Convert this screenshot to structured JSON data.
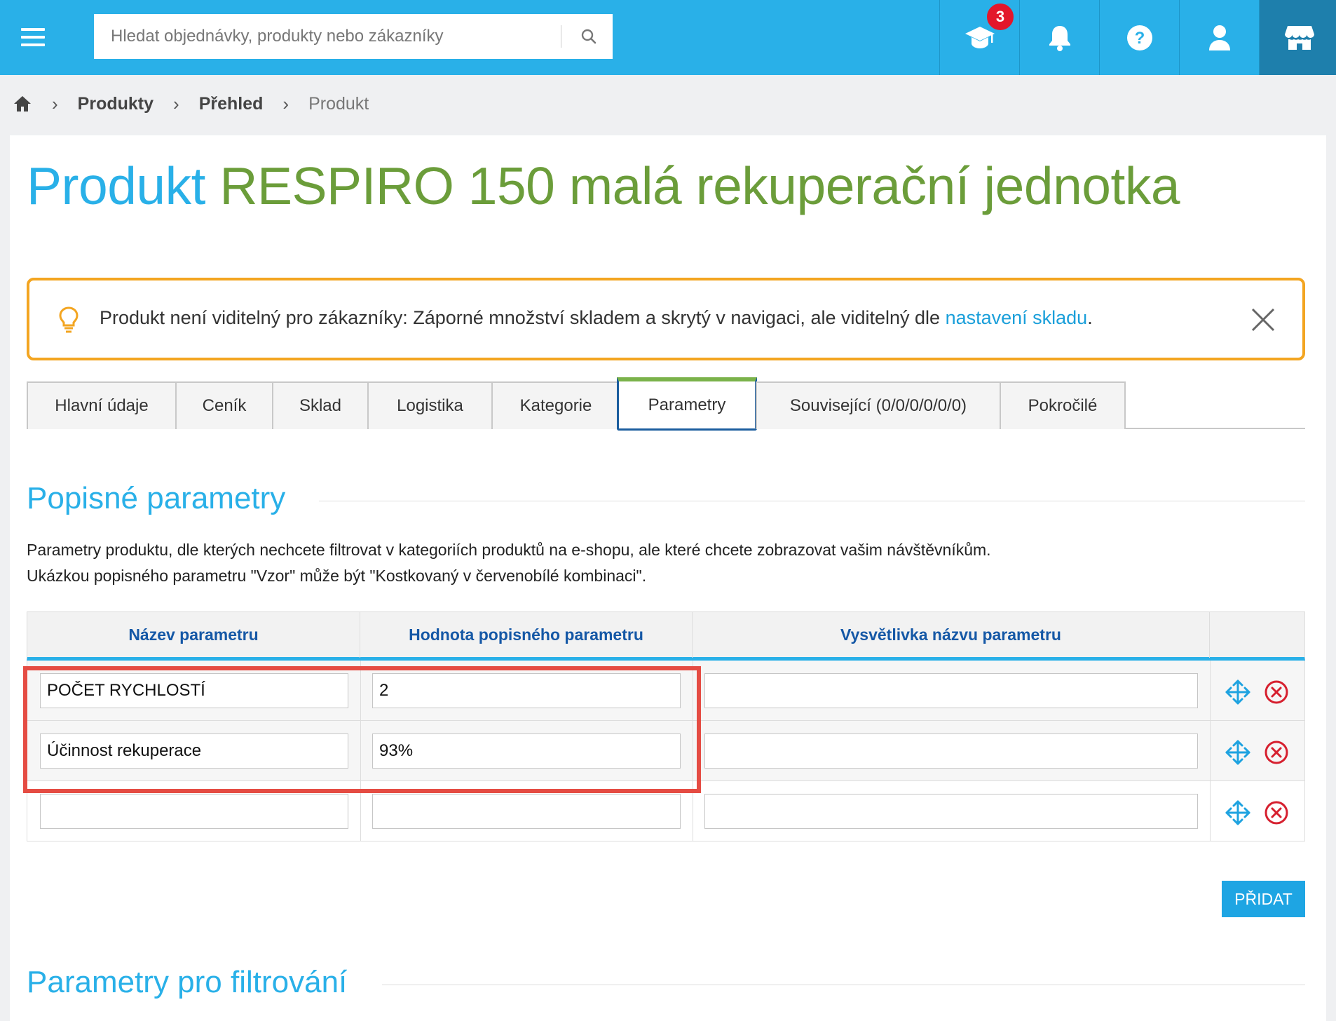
{
  "topbar": {
    "search_placeholder": "Hledat objednávky, produkty nebo zákazníky",
    "notification_count": "3",
    "icons": [
      "menu-icon",
      "search-icon",
      "academy-icon",
      "bell-icon",
      "help-icon",
      "user-icon",
      "store-icon"
    ]
  },
  "breadcrumb": {
    "items": [
      "Produkty",
      "Přehled"
    ],
    "current": "Produkt"
  },
  "page": {
    "title_prefix": "Produkt",
    "title_name": "RESPIRO 150 malá rekuperační jednotka"
  },
  "notice": {
    "text": "Produkt není viditelný pro zákazníky: Záporné množství skladem a skrytý v navigaci, ale viditelný dle ",
    "link": "nastavení skladu",
    "suffix": "."
  },
  "tabs": [
    {
      "label": "Hlavní údaje"
    },
    {
      "label": "Ceník"
    },
    {
      "label": "Sklad"
    },
    {
      "label": "Logistika"
    },
    {
      "label": "Kategorie"
    },
    {
      "label": "Parametry",
      "active": true
    },
    {
      "label": "Související (0/0/0/0/0/0)"
    },
    {
      "label": "Pokročilé"
    }
  ],
  "descriptive": {
    "title": "Popisné parametry",
    "desc_line1": "Parametry produktu, dle kterých nechcete filtrovat v kategoriích produktů na e-shopu, ale které chcete zobrazovat vašim návštěvníkům.",
    "desc_line2": "Ukázkou popisného parametru \"Vzor\" může být \"Kostkovaný v červenobílé kombinaci\".",
    "columns": [
      "Název parametru",
      "Hodnota popisného parametru",
      "Vysvětlivka názvu parametru"
    ],
    "rows": [
      {
        "name": "POČET RYCHLOSTÍ",
        "value": "2",
        "note": ""
      },
      {
        "name": "Účinnost rekuperace",
        "value": "93%",
        "note": ""
      },
      {
        "name": "",
        "value": "",
        "note": ""
      }
    ],
    "add_label": "PŘIDAT"
  },
  "filtering": {
    "title": "Parametry pro filtrování"
  },
  "colors": {
    "brand": "#29b0e8",
    "product_name": "#6b9d3a",
    "warning_border": "#f3a521",
    "highlight": "#e54c43",
    "delete": "#d6202f"
  }
}
